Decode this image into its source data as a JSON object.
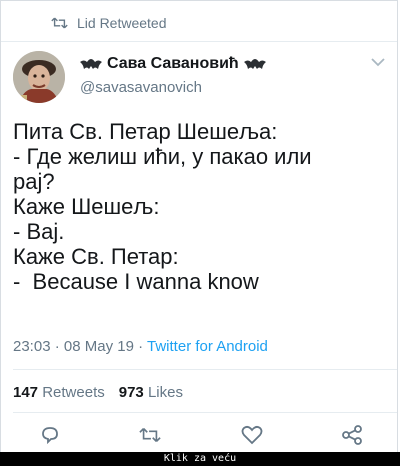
{
  "retweet_banner": {
    "text": "Lid Retweeted",
    "icon": "retweet-icon"
  },
  "author": {
    "display_name": "Сава Савановић",
    "handle": "@savasavanovich",
    "avatar_icon": "avatar"
  },
  "tweet": {
    "lines": [
      "Пита Св. Петар Шешеља:",
      "- Где желиш ићи, у пакао или",
      "рај?",
      "Каже Шешељ:",
      "- Вај.",
      "Каже Св. Петар:",
      "-  Because I wanna know"
    ]
  },
  "meta": {
    "time": "23:03",
    "dot1": "·",
    "date": "08 May 19",
    "dot2": "·",
    "source": "Twitter for Android"
  },
  "stats": {
    "retweets_count": "147",
    "retweets_label": "Retweets",
    "likes_count": "973",
    "likes_label": "Likes"
  },
  "actions": [
    "reply-icon",
    "retweet-icon",
    "like-icon",
    "share-icon"
  ],
  "caption": "Klik za veću",
  "colors": {
    "secondary": "#657786",
    "link": "#1da1f2",
    "text": "#14171a"
  }
}
